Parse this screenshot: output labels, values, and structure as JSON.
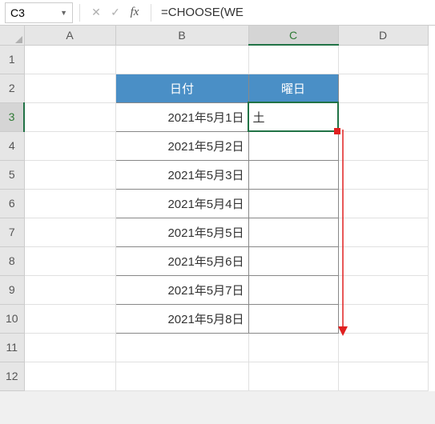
{
  "nameBox": {
    "value": "C3"
  },
  "formulaBar": {
    "cancel": "✕",
    "confirm": "✓",
    "fx": "fx",
    "formula": "=CHOOSE(WE"
  },
  "columns": [
    "A",
    "B",
    "C",
    "D"
  ],
  "rows": [
    "1",
    "2",
    "3",
    "4",
    "5",
    "6",
    "7",
    "8",
    "9",
    "10",
    "11",
    "12"
  ],
  "activeCell": {
    "col": "C",
    "row": "3"
  },
  "table": {
    "headers": {
      "date": "日付",
      "weekday": "曜日"
    },
    "data": [
      {
        "date": "2021年5月1日",
        "weekday": "土"
      },
      {
        "date": "2021年5月2日",
        "weekday": ""
      },
      {
        "date": "2021年5月3日",
        "weekday": ""
      },
      {
        "date": "2021年5月4日",
        "weekday": ""
      },
      {
        "date": "2021年5月5日",
        "weekday": ""
      },
      {
        "date": "2021年5月6日",
        "weekday": ""
      },
      {
        "date": "2021年5月7日",
        "weekday": ""
      },
      {
        "date": "2021年5月8日",
        "weekday": ""
      }
    ]
  },
  "colors": {
    "tableHeaderBg": "#4a8fc6",
    "selection": "#217346",
    "arrow": "#e02020"
  }
}
